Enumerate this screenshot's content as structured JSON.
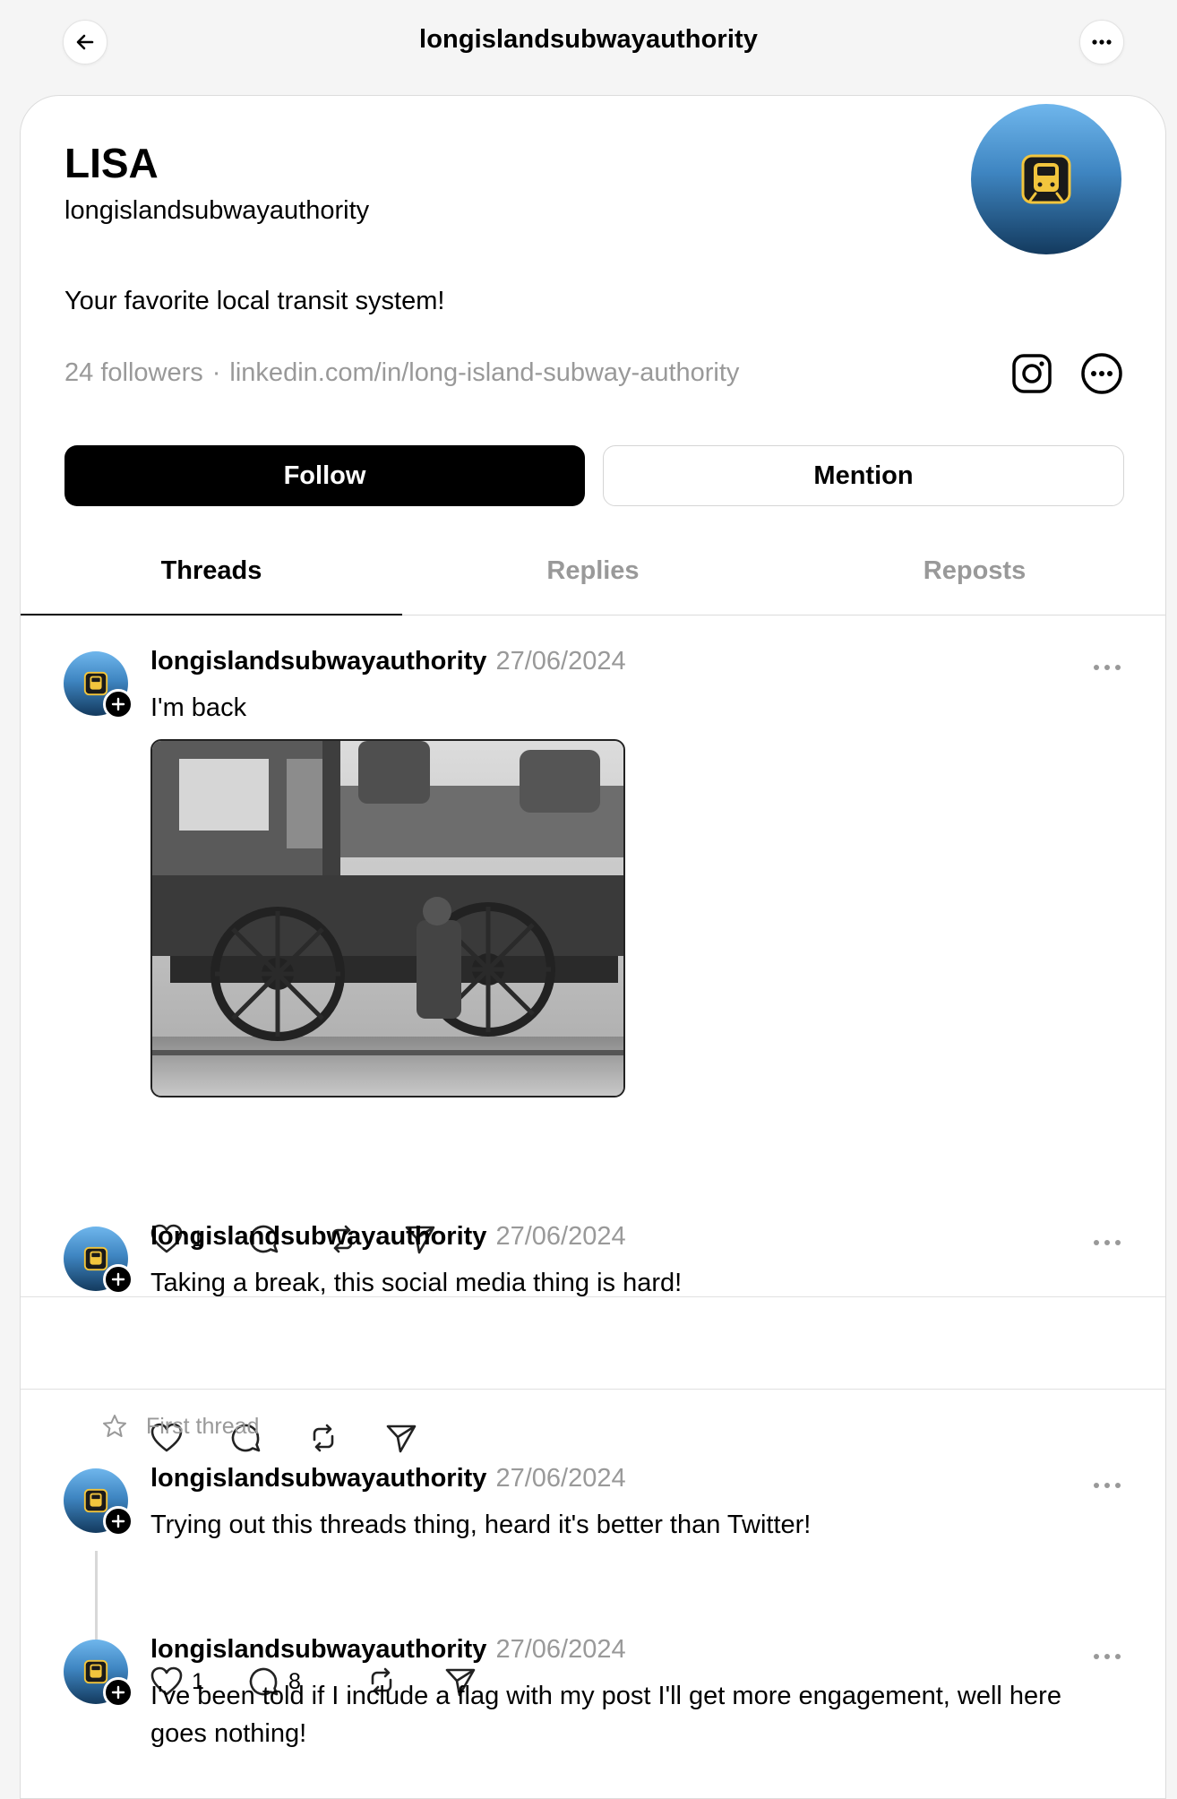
{
  "topbar": {
    "title": "longislandsubwayauthority",
    "back_icon": "arrow-left-icon",
    "more_icon": "ellipsis-icon"
  },
  "profile": {
    "display_name": "LISA",
    "handle": "longislandsubwayauthority",
    "bio": "Your favorite local transit system!",
    "followers": "24 followers",
    "separator": "·",
    "link": "linkedin.com/in/long-island-subway-authority",
    "avatar_icon": "train-icon",
    "accent": "#3f86c2"
  },
  "buttons": {
    "follow": "Follow",
    "mention": "Mention"
  },
  "tabs": [
    {
      "label": "Threads",
      "active": true
    },
    {
      "label": "Replies",
      "active": false
    },
    {
      "label": "Reposts",
      "active": false
    }
  ],
  "posts": [
    {
      "user": "longislandsubwayauthority",
      "date": "27/06/2024",
      "text": "I'm back",
      "has_image": true,
      "image_icon": "steam-locomotive-photo",
      "likes": "1",
      "replies": "",
      "reposts": "",
      "sends": ""
    },
    {
      "user": "longislandsubwayauthority",
      "date": "27/06/2024",
      "text": "Taking a break, this social media thing is hard!",
      "has_image": false,
      "likes": "",
      "replies": "",
      "reposts": "",
      "sends": ""
    },
    {
      "pinned_label": "First thread",
      "user": "longislandsubwayauthority",
      "date": "27/06/2024",
      "text": "Trying out this threads thing, heard it's better than Twitter!",
      "has_image": false,
      "likes": "1",
      "replies": "8",
      "reposts": "",
      "sends": ""
    },
    {
      "user": "longislandsubwayauthority",
      "date": "27/06/2024",
      "text": "I've been told if I include a flag with my post I'll get more engagement, well here goes nothing!",
      "has_image": false
    }
  ],
  "colors": {
    "muted_text": "#999999",
    "background": "#f5f5f5",
    "card": "#ffffff"
  }
}
